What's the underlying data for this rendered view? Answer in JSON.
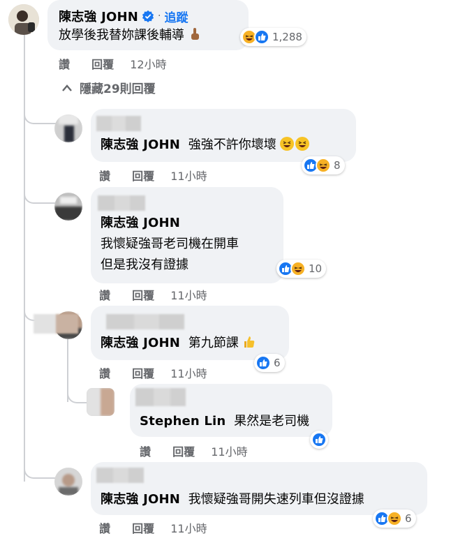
{
  "top_comment": {
    "author": "陳志強 JOHN",
    "separator": "·",
    "follow_label": "追蹤",
    "text": "放學後我替妳課後輔導",
    "reaction_count": "1,288",
    "actions": {
      "like": "讚",
      "reply": "回覆",
      "time": "12小時"
    }
  },
  "hide_replies": {
    "label": "隱藏29則回覆"
  },
  "replies": [
    {
      "author": "陳志強 JOHN",
      "text": "強強不許你壞壞",
      "reaction_count": "8",
      "actions": {
        "like": "讚",
        "reply": "回覆",
        "time": "11小時"
      }
    },
    {
      "author": "陳志強 JOHN",
      "lines": [
        "我懷疑強哥老司機在開車",
        "但是我沒有證據"
      ],
      "reaction_count": "10",
      "actions": {
        "like": "讚",
        "reply": "回覆",
        "time": "11小時"
      }
    },
    {
      "author": "陳志強 JOHN",
      "text": "第九節課",
      "reaction_count": "6",
      "actions": {
        "like": "讚",
        "reply": "回覆",
        "time": "11小時"
      }
    },
    {
      "author": "Stephen Lin",
      "text": "果然是老司機",
      "actions": {
        "like": "讚",
        "reply": "回覆",
        "time": "11小時"
      }
    },
    {
      "author": "陳志強 JOHN",
      "text": "我懷疑強哥開失速列車但沒證據",
      "reaction_count": "6",
      "actions": {
        "like": "讚",
        "reply": "回覆",
        "time": "11小時"
      }
    }
  ],
  "colors": {
    "bubble": "#f0f2f5",
    "like_blue": "#1877f2",
    "haha_yellow": "#f7b125",
    "muted": "#65676b",
    "thread": "#ced0d4"
  },
  "icons": [
    "verified-badge-icon",
    "point-up-emoji-icon",
    "like-reaction-icon",
    "haha-reaction-icon",
    "grinning-squint-emoji-icon",
    "thumbs-up-emoji-icon",
    "chevron-up-icon"
  ]
}
